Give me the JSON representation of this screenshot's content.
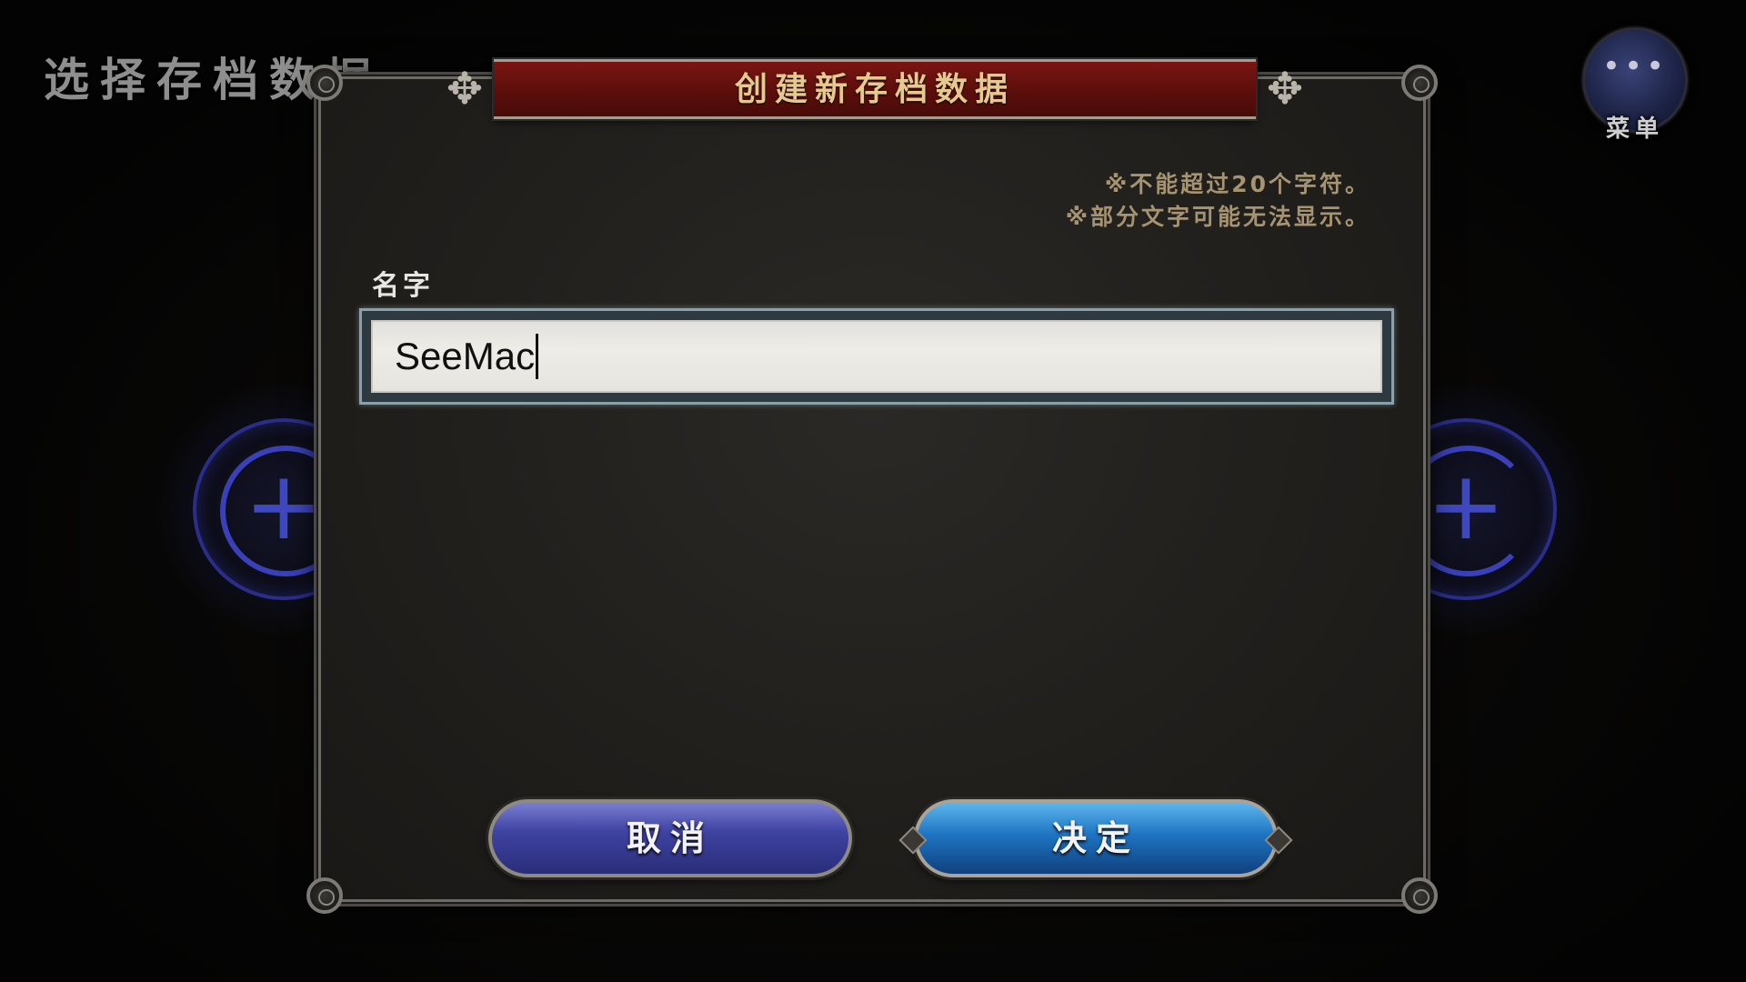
{
  "screen": {
    "title": "选择存档数据"
  },
  "menu": {
    "dots": "•••",
    "label": "菜单"
  },
  "background_slots": {
    "left_icon": "plus-icon",
    "right_icon": "plus-icon",
    "plus_glyph": "+"
  },
  "dialog": {
    "title": "创建新存档数据",
    "notes": [
      "※不能超过20个字符。",
      "※部分文字可能无法显示。"
    ],
    "name_label": "名字",
    "name_value": "SeeMac",
    "cancel_label": "取消",
    "confirm_label": "决定"
  },
  "colors": {
    "banner": "#5e0f0c",
    "banner_text": "#e6c98e",
    "cancel_button": "#3f43a2",
    "confirm_button": "#1e74c2",
    "notes_text": "#a59371"
  }
}
